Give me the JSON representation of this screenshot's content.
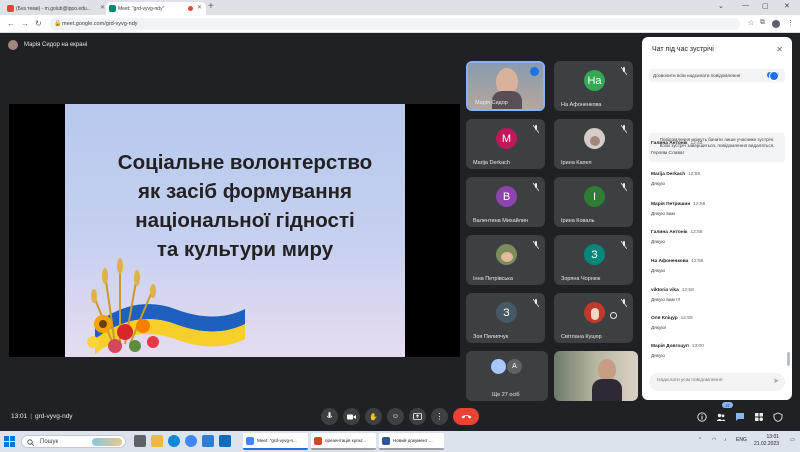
{
  "browser": {
    "tabs": [
      {
        "title": "(Без теми) - m.golub@ippo.edu...",
        "favicon_color": "#ea4335",
        "active": false
      },
      {
        "title": "Meet: \"grd-vyvg-ndy\"",
        "favicon_color": "#00897b",
        "active": true
      }
    ],
    "new_tab_label": "+",
    "url": "meet.google.com/grd-vyvg-ndy"
  },
  "meet": {
    "presenter_label": "Марія Сидор на екрані",
    "slide": {
      "lines": [
        "Соціальне волонтерство",
        "як засіб формування",
        "національної гідності",
        "та культури миру"
      ]
    },
    "participants": [
      {
        "name": "Марія Сидор",
        "avatar": "",
        "color": "#b08d7a",
        "video": true,
        "selected": true,
        "mic": "active"
      },
      {
        "name": "На Афоненкова",
        "avatar": "На",
        "color": "#34a853",
        "mic": "muted"
      },
      {
        "name": "Marija Derkach",
        "avatar": "M",
        "color": "#c2185b",
        "mic": "muted"
      },
      {
        "name": "Ірина Капел",
        "avatar": "",
        "color": "#a1887f",
        "photo": true,
        "mic": "muted"
      },
      {
        "name": "Валентина Михайлин",
        "avatar": "В",
        "color": "#8e44ad",
        "mic": "muted"
      },
      {
        "name": "Ірина Коваль",
        "avatar": "І",
        "color": "#2e7d32",
        "mic": "muted"
      },
      {
        "name": "Інна Петрівська",
        "avatar": "",
        "color": "#7b8d5a",
        "photo": true,
        "mic": "muted"
      },
      {
        "name": "Зоряна Чорнюк",
        "avatar": "З",
        "color": "#00897b",
        "mic": "muted"
      },
      {
        "name": "Зоя Пилипчук",
        "avatar": "З",
        "color": "#455a64",
        "mic": "muted"
      },
      {
        "name": "Світлана Куцюр",
        "avatar": "",
        "color": "#c0392b",
        "photo": true,
        "mic": "muted"
      }
    ],
    "more_tile": {
      "label": "Ще 27 осіб",
      "avatars": [
        "",
        "A"
      ]
    },
    "meeting_time": "13:01",
    "meeting_code": "grd-vyvg-ndy",
    "participant_count": "37"
  },
  "chat": {
    "title": "Чат під час зустрічі",
    "toggle_label": "Дозволити всім надсилати повідомлення",
    "toggle_on": true,
    "notice": "Повідомлення можуть бачити лише учасники зустрічі. Коли зустріч завершиться, повідомлення видаляться.",
    "messages": [
      {
        "sender": "Галина Антонік",
        "time": "12:43",
        "text": "Героям Слава!"
      },
      {
        "sender": "Marija Derkach",
        "time": "12:58",
        "text": "Дякую"
      },
      {
        "sender": "Марія Петришин",
        "time": "12:58",
        "text": "Дякую вам"
      },
      {
        "sender": "Галина Антонік",
        "time": "12:58",
        "text": "Дякую"
      },
      {
        "sender": "На Афоненкова",
        "time": "12:58",
        "text": "Дякую"
      },
      {
        "sender": "viktoria vika",
        "time": "12:58",
        "text": "Дякую вам !!!"
      },
      {
        "sender": "Оля Кліцур",
        "time": "12:59",
        "text": "Дякую!"
      },
      {
        "sender": "Марія Довгоцуп",
        "time": "13:00",
        "text": "Дякую"
      }
    ],
    "input_placeholder": "Надіслати усім повідомлення"
  },
  "taskbar": {
    "search_label": "Пошук",
    "apps": [
      {
        "title": "Meet: \"grd-vyvg-n...",
        "color": "#4285f4"
      },
      {
        "title": "презентація культ...",
        "color": "#d24726"
      },
      {
        "title": "Новий документ ...",
        "color": "#2b579a"
      }
    ],
    "language": "ENG",
    "time": "13:01",
    "date": "21.02.2023"
  }
}
